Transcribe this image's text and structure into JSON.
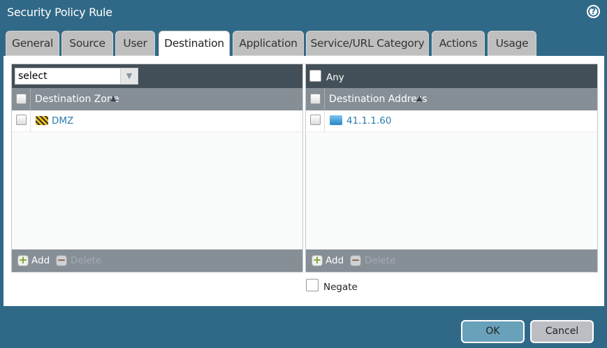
{
  "window": {
    "title": "Security Policy Rule",
    "help_icon": "?"
  },
  "tabs": [
    {
      "label": "General"
    },
    {
      "label": "Source"
    },
    {
      "label": "User"
    },
    {
      "label": "Destination",
      "active": true
    },
    {
      "label": "Application"
    },
    {
      "label": "Service/URL Category"
    },
    {
      "label": "Actions"
    },
    {
      "label": "Usage"
    }
  ],
  "zone_panel": {
    "select_value": "select",
    "column": "Destination Zone",
    "rows": [
      {
        "name": "DMZ"
      }
    ],
    "add": "Add",
    "delete": "Delete"
  },
  "address_panel": {
    "any_label": "Any",
    "column": "Destination Address",
    "rows": [
      {
        "name": "41.1.1.60"
      }
    ],
    "add": "Add",
    "delete": "Delete"
  },
  "negate_label": "Negate",
  "buttons": {
    "ok": "OK",
    "cancel": "Cancel"
  }
}
